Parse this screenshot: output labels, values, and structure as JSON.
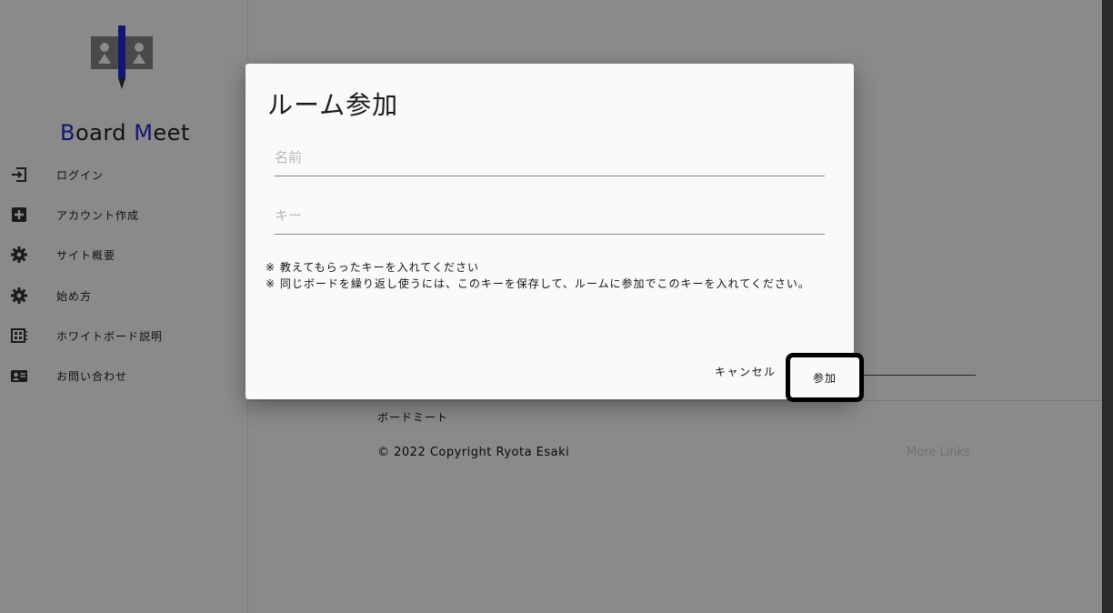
{
  "app": {
    "brand_b": "B",
    "brand_oard": "oard",
    "brand_m": "M",
    "brand_eet": "eet"
  },
  "sidebar": {
    "items": [
      {
        "icon": "login-icon",
        "label": "ログイン"
      },
      {
        "icon": "plus-box-icon",
        "label": "アカウント作成"
      },
      {
        "icon": "gear-icon",
        "label": "サイト概要"
      },
      {
        "icon": "gear-icon",
        "label": "始め方"
      },
      {
        "icon": "whiteboard-icon",
        "label": "ホワイトボード説明"
      },
      {
        "icon": "contact-card-icon",
        "label": "お問い合わせ"
      }
    ]
  },
  "footer": {
    "title": "ボードミート",
    "copyright": "© 2022 Copyright Ryota Esaki",
    "more_links": "More Links"
  },
  "dialog": {
    "title": "ルーム参加",
    "name_placeholder": "名前",
    "key_placeholder": "キー",
    "note_line1": "※ 教えてもらったキーを入れてください",
    "note_line2": "※ 同じボードを繰り返し使うには、このキーを保存して、ルームに参加でこのキーを入れてください。",
    "cancel_label": "キャンセル",
    "join_label": "参加"
  },
  "colors": {
    "brand_accent": "#1f2bd1",
    "scrim": "rgba(0,0,0,0.46)"
  }
}
